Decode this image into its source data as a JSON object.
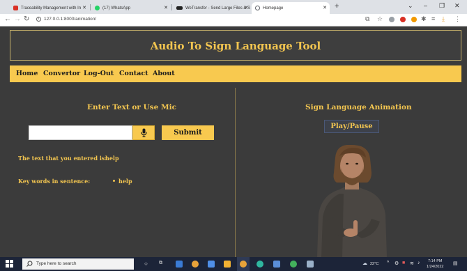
{
  "browser": {
    "tabs": [
      {
        "label": "Traceability Management with In",
        "color": "#d93025"
      },
      {
        "label": "(17) WhatsApp",
        "color": "#25d366"
      },
      {
        "label": "WeTransfer - Send Large Files & S",
        "color": "#222222"
      },
      {
        "label": "Homepage",
        "color": "#5f6368"
      }
    ],
    "url": "127.0.0.1:8000/animation/"
  },
  "app": {
    "title": "Audio To Sign Language Tool",
    "nav": [
      "Home",
      "Convertor",
      "Log-Out",
      "Contact",
      "About"
    ],
    "left_panel": {
      "title": "Enter Text or Use Mic",
      "input_value": "",
      "submit_label": "Submit",
      "entered_label": "The text that you entered is:",
      "entered_value": "help",
      "keywords_label": "Key words in sentence:",
      "keywords": [
        "help"
      ]
    },
    "right_panel": {
      "title": "Sign Language Animation",
      "play_pause_label": "Play/Pause"
    },
    "colors": {
      "accent": "#f8c94f",
      "text_accent": "#f2c550",
      "background": "#3b3b3b"
    }
  },
  "taskbar": {
    "search_placeholder": "Type here to search",
    "weather": "22°C",
    "time": "7:14 PM",
    "date": "1/24/2022"
  }
}
